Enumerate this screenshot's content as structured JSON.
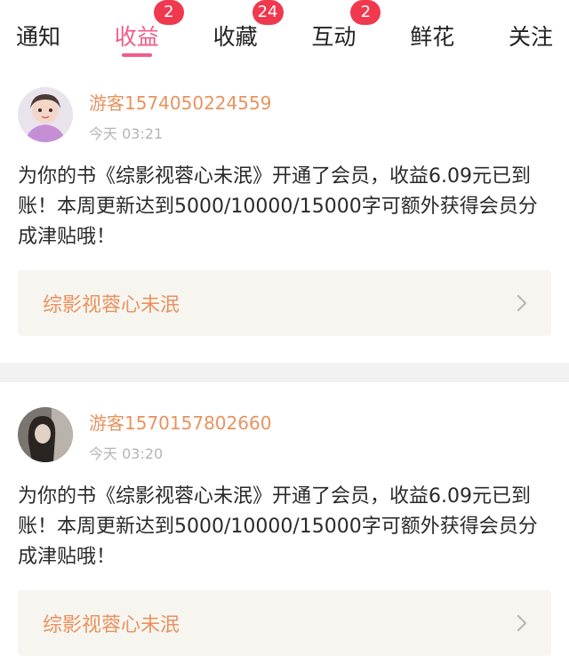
{
  "tabs": [
    {
      "label": "通知",
      "badge": null,
      "active": false
    },
    {
      "label": "收益",
      "badge": "2",
      "active": true
    },
    {
      "label": "收藏",
      "badge": "24",
      "active": false
    },
    {
      "label": "互动",
      "badge": "2",
      "active": false
    },
    {
      "label": "鲜花",
      "badge": null,
      "active": false
    },
    {
      "label": "关注",
      "badge": null,
      "active": false
    }
  ],
  "messages": [
    {
      "username": "游客1574050224559",
      "time": "今天 03:21",
      "content": "为你的书《综影视蓉心未泯》开通了会员，收益6.09元已到账！本周更新达到5000/10000/15000字可额外获得会员分成津贴哦！",
      "book_title": "综影视蓉心未泯"
    },
    {
      "username": "游客1570157802660",
      "time": "今天 03:20",
      "content": "为你的书《综影视蓉心未泯》开通了会员，收益6.09元已到账！本周更新达到5000/10000/15000字可额外获得会员分成津贴哦！",
      "book_title": "综影视蓉心未泯"
    }
  ],
  "colors": {
    "accent": "#f15b8a",
    "badge": "#f0394e",
    "username": "#e8935e",
    "link_bg": "#f7f5f0"
  }
}
